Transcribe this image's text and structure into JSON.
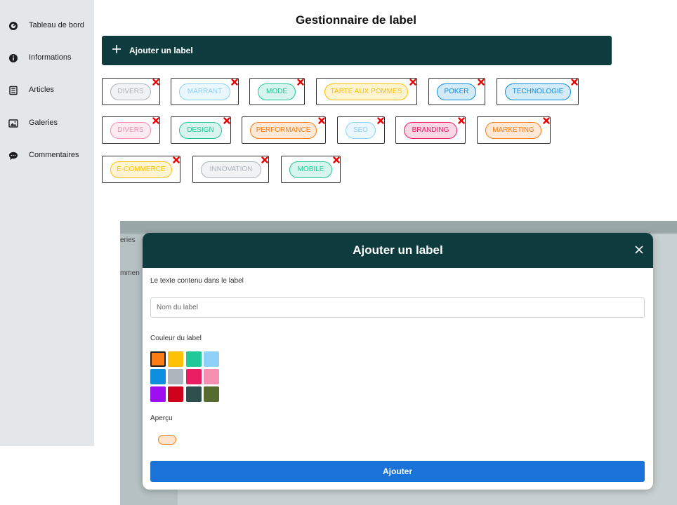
{
  "sidebar": {
    "items": [
      {
        "label": "Tableau de bord",
        "icon": "dashboard-icon"
      },
      {
        "label": "Informations",
        "icon": "info-icon"
      },
      {
        "label": "Articles",
        "icon": "article-icon"
      },
      {
        "label": "Galeries",
        "icon": "gallery-icon"
      },
      {
        "label": "Commentaires",
        "icon": "comment-icon"
      }
    ]
  },
  "header": {
    "title": "Gestionnaire de label"
  },
  "add_bar": {
    "label": "Ajouter un label"
  },
  "labels": [
    {
      "text": "DIVERS",
      "color": "#adb5bd"
    },
    {
      "text": "MARRANT",
      "color": "#8fd0f8"
    },
    {
      "text": "MODE",
      "color": "#20c997"
    },
    {
      "text": "TARTE AUX POMMES",
      "color": "#ffc107"
    },
    {
      "text": "POKER",
      "color": "#0d8ee0"
    },
    {
      "text": "TECHNOLOGIE",
      "color": "#0d8ee0"
    },
    {
      "text": "DIVERS",
      "color": "#f48fb1"
    },
    {
      "text": "DESIGN",
      "color": "#20c997"
    },
    {
      "text": "PERFORMANCE",
      "color": "#fd7e14"
    },
    {
      "text": "SEO",
      "color": "#8fd0f8"
    },
    {
      "text": "BRANDING",
      "color": "#e91e63"
    },
    {
      "text": "MARKETING",
      "color": "#fd7e14"
    },
    {
      "text": "E-COMMERCE",
      "color": "#ffc107"
    },
    {
      "text": "INNOVATION",
      "color": "#adb5bd"
    },
    {
      "text": "MOBILE",
      "color": "#20c997"
    }
  ],
  "background_ghost": {
    "item1": "eries",
    "item2": "mmen"
  },
  "modal": {
    "title": "Ajouter un label",
    "text_label": "Le texte contenu dans le label",
    "name_placeholder": "Nom du label",
    "name_value": "",
    "color_label": "Couleur du label",
    "colors": [
      "#fd7e14",
      "#ffc107",
      "#20c997",
      "#8fd0f8",
      "#0d8ee0",
      "#adb5bd",
      "#e91e63",
      "#f48fb1",
      "#9c0df0",
      "#d0021b",
      "#2f4f4f",
      "#556b2f"
    ],
    "selected_color": "#fd7e14",
    "preview_label": "Aperçu",
    "submit_label": "Ajouter"
  }
}
